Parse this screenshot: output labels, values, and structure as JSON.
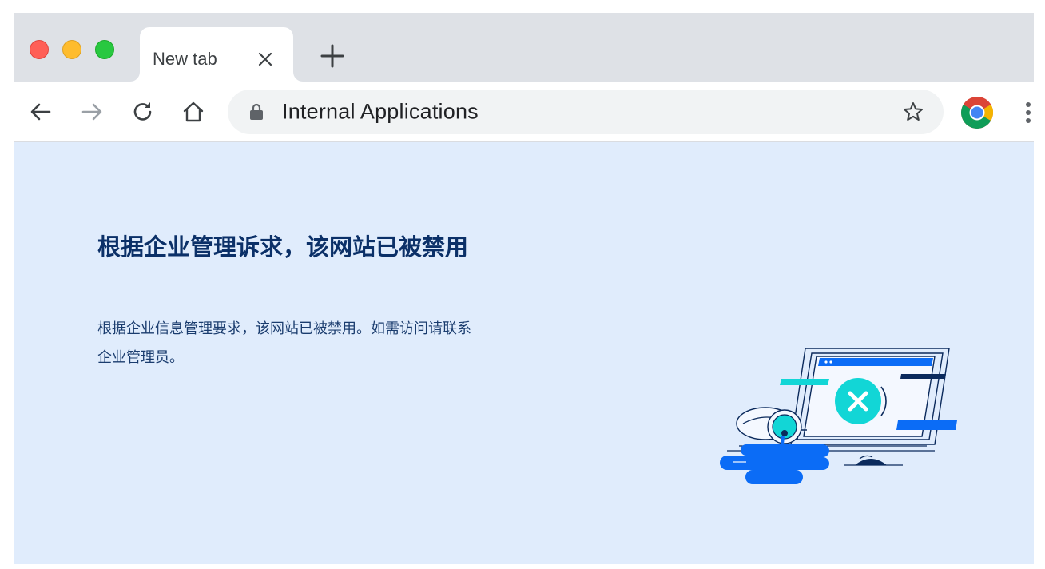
{
  "browser": {
    "tab": {
      "title": "New tab",
      "close_icon": "close-icon"
    },
    "new_tab_icon": "plus-icon",
    "toolbar": {
      "back_icon": "back-arrow-icon",
      "forward_icon": "forward-arrow-icon",
      "reload_icon": "reload-icon",
      "home_icon": "home-icon"
    },
    "omnibox": {
      "security_icon": "lock-icon",
      "text": "Internal Applications",
      "bookmark_icon": "star-icon"
    },
    "profile_icon": "chrome-logo-icon",
    "menu_icon": "more-vert-icon"
  },
  "page": {
    "heading": "根据企业管理诉求，该网站已被禁用",
    "message": "根据企业信息管理要求，该网站已被禁用。如需访问请联系企业管理员。",
    "illustration": "blocked-site-illustration"
  },
  "colors": {
    "tabstrip": "#dee1e6",
    "content_bg": "#e0ecfc",
    "heading": "#0b3068",
    "accent_blue": "#0b6cf6",
    "accent_cyan": "#12d6d6",
    "dark_navy": "#0b2a5c"
  }
}
